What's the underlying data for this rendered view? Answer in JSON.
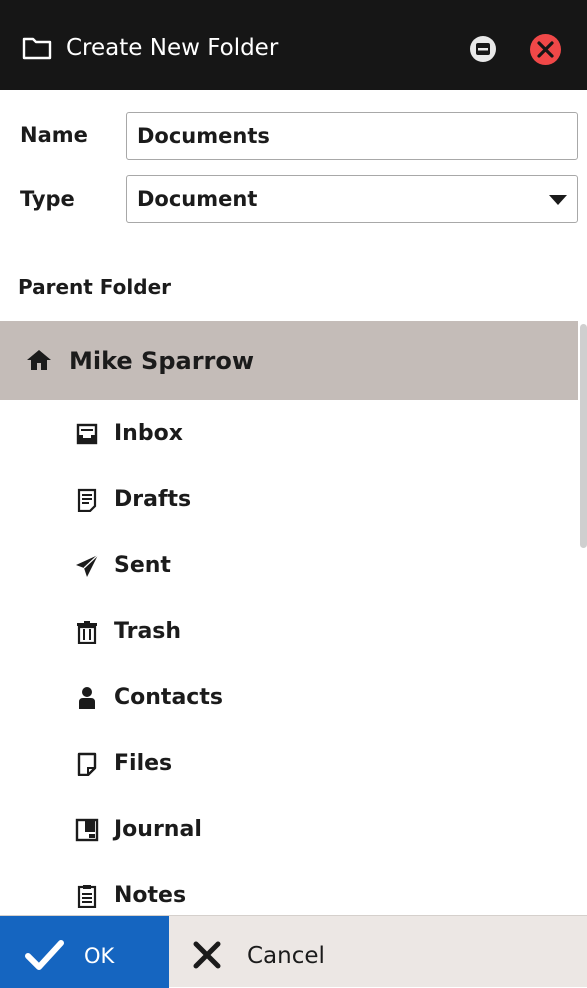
{
  "window": {
    "title": "Create New Folder",
    "title_icon": "folder-icon",
    "controls": [
      "minimize-icon",
      "close-icon"
    ],
    "close_color": "#f04848"
  },
  "form": {
    "name_label": "Name",
    "name_value": "Documents",
    "type_label": "Type",
    "type_value": "Document",
    "parent_label": "Parent Folder"
  },
  "tree": {
    "root": {
      "label": "Mike Sparrow",
      "icon": "home-icon",
      "selected": true
    },
    "items": [
      {
        "label": "Inbox",
        "icon": "inbox-icon"
      },
      {
        "label": "Drafts",
        "icon": "drafts-icon"
      },
      {
        "label": "Sent",
        "icon": "paper-plane-icon"
      },
      {
        "label": "Trash",
        "icon": "trash-icon"
      },
      {
        "label": "Contacts",
        "icon": "person-icon"
      },
      {
        "label": "Files",
        "icon": "file-icon"
      },
      {
        "label": "Journal",
        "icon": "journal-icon"
      },
      {
        "label": "Notes",
        "icon": "notes-icon"
      }
    ]
  },
  "buttons": {
    "ok_label": "OK",
    "cancel_label": "Cancel",
    "ok_color": "#1565c0"
  }
}
